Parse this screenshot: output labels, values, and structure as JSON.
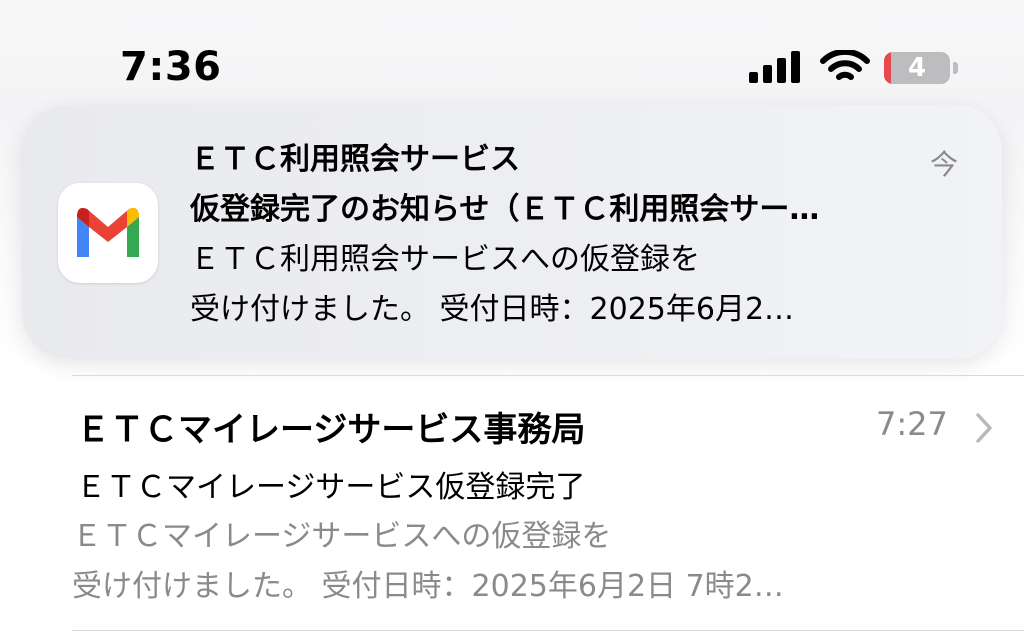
{
  "status_bar": {
    "time": "7:36",
    "battery_level": "4",
    "icons": [
      "cellular-signal-icon",
      "wifi-icon",
      "battery-icon"
    ]
  },
  "notification": {
    "app_icon": "gmail-icon",
    "sender": "ＥＴＣ利用照会サービス",
    "subject": "仮登録完了のお知らせ（ＥＴＣ利用照会サー…",
    "preview_line1": "ＥＴＣ利用照会サービスへの仮登録を",
    "preview_line2": "受け付けました。 受付日時：2025年6月2…",
    "time": "今"
  },
  "mail_row": {
    "sender": "ＥＴＣマイレージサービス事務局",
    "time": "7:27",
    "subject": "ＥＴＣマイレージサービス仮登録完了",
    "preview_line1": "ＥＴＣマイレージサービスへの仮登録を",
    "preview_line2": "受け付けました。 受付日時：2025年6月2日 7時2…",
    "chevron_icon": "chevron-right-icon"
  },
  "colors": {
    "secondary_text": "#8a8a8e",
    "battery_low": "#e5484d",
    "gmail_red": "#ea4335",
    "gmail_blue": "#4285f4",
    "gmail_green": "#34a853",
    "gmail_yellow": "#fbbc04"
  }
}
